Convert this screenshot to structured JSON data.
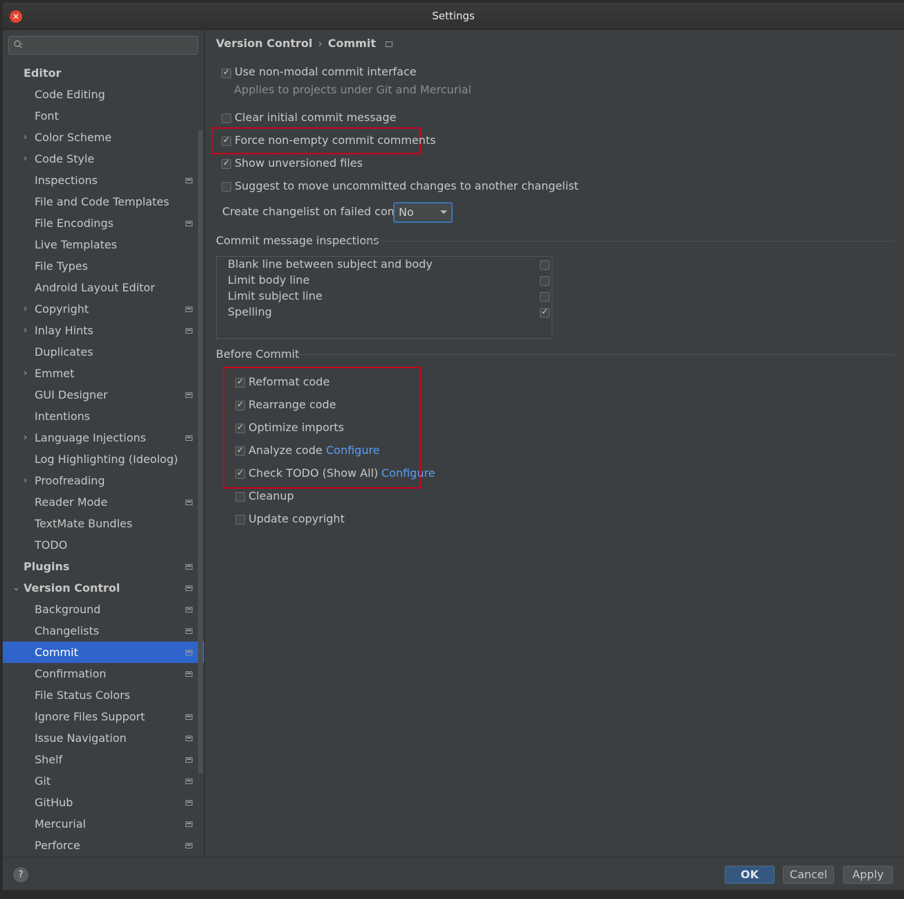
{
  "window": {
    "title": "Settings"
  },
  "search": {
    "placeholder": ""
  },
  "sidebar": {
    "items": [
      {
        "label": "Editor",
        "bold": true,
        "indent": 0,
        "arrow": "",
        "proj": false
      },
      {
        "label": "Code Editing",
        "indent": 1,
        "arrow": "",
        "proj": false
      },
      {
        "label": "Font",
        "indent": 1,
        "arrow": "",
        "proj": false
      },
      {
        "label": "Color Scheme",
        "indent": 1,
        "arrow": "›",
        "proj": false
      },
      {
        "label": "Code Style",
        "indent": 1,
        "arrow": "›",
        "proj": false
      },
      {
        "label": "Inspections",
        "indent": 1,
        "arrow": "",
        "proj": true
      },
      {
        "label": "File and Code Templates",
        "indent": 1,
        "arrow": "",
        "proj": false
      },
      {
        "label": "File Encodings",
        "indent": 1,
        "arrow": "",
        "proj": true
      },
      {
        "label": "Live Templates",
        "indent": 1,
        "arrow": "",
        "proj": false
      },
      {
        "label": "File Types",
        "indent": 1,
        "arrow": "",
        "proj": false
      },
      {
        "label": "Android Layout Editor",
        "indent": 1,
        "arrow": "",
        "proj": false
      },
      {
        "label": "Copyright",
        "indent": 1,
        "arrow": "›",
        "proj": true
      },
      {
        "label": "Inlay Hints",
        "indent": 1,
        "arrow": "›",
        "proj": true
      },
      {
        "label": "Duplicates",
        "indent": 1,
        "arrow": "",
        "proj": false
      },
      {
        "label": "Emmet",
        "indent": 1,
        "arrow": "›",
        "proj": false
      },
      {
        "label": "GUI Designer",
        "indent": 1,
        "arrow": "",
        "proj": true
      },
      {
        "label": "Intentions",
        "indent": 1,
        "arrow": "",
        "proj": false
      },
      {
        "label": "Language Injections",
        "indent": 1,
        "arrow": "›",
        "proj": true
      },
      {
        "label": "Log Highlighting (Ideolog)",
        "indent": 1,
        "arrow": "",
        "proj": false
      },
      {
        "label": "Proofreading",
        "indent": 1,
        "arrow": "›",
        "proj": false
      },
      {
        "label": "Reader Mode",
        "indent": 1,
        "arrow": "",
        "proj": true
      },
      {
        "label": "TextMate Bundles",
        "indent": 1,
        "arrow": "",
        "proj": false
      },
      {
        "label": "TODO",
        "indent": 1,
        "arrow": "",
        "proj": false
      },
      {
        "label": "Plugins",
        "bold": true,
        "indent": 0,
        "arrow": "",
        "proj": true
      },
      {
        "label": "Version Control",
        "bold": true,
        "indent": 0,
        "arrow": "⌄",
        "proj": true
      },
      {
        "label": "Background",
        "indent": 1,
        "arrow": "",
        "proj": true
      },
      {
        "label": "Changelists",
        "indent": 1,
        "arrow": "",
        "proj": true
      },
      {
        "label": "Commit",
        "indent": 1,
        "arrow": "",
        "proj": true,
        "selected": true
      },
      {
        "label": "Confirmation",
        "indent": 1,
        "arrow": "",
        "proj": true
      },
      {
        "label": "File Status Colors",
        "indent": 1,
        "arrow": "",
        "proj": false
      },
      {
        "label": "Ignore Files Support",
        "indent": 1,
        "arrow": "",
        "proj": true
      },
      {
        "label": "Issue Navigation",
        "indent": 1,
        "arrow": "",
        "proj": true
      },
      {
        "label": "Shelf",
        "indent": 1,
        "arrow": "",
        "proj": true
      },
      {
        "label": "Git",
        "indent": 1,
        "arrow": "",
        "proj": true
      },
      {
        "label": "GitHub",
        "indent": 1,
        "arrow": "",
        "proj": true
      },
      {
        "label": "Mercurial",
        "indent": 1,
        "arrow": "",
        "proj": true
      },
      {
        "label": "Perforce",
        "indent": 1,
        "arrow": "",
        "proj": true
      }
    ]
  },
  "breadcrumb": {
    "parent": "Version Control",
    "sep": "›",
    "current": "Commit"
  },
  "options": {
    "non_modal": {
      "label": "Use non-modal commit interface",
      "checked": true
    },
    "non_modal_hint": "Applies to projects under Git and Mercurial",
    "clear_initial": {
      "label": "Clear initial commit message",
      "checked": false
    },
    "force_non_empty": {
      "label": "Force non-empty commit comments",
      "checked": true
    },
    "show_unversioned": {
      "label": "Show unversioned files",
      "checked": true
    },
    "suggest_move": {
      "label": "Suggest to move uncommitted changes to another changelist",
      "checked": false
    },
    "create_changelist_label": "Create changelist on failed commit:",
    "create_changelist_value": "No"
  },
  "inspections": {
    "title": "Commit message inspections",
    "items": [
      {
        "label": "Blank line between subject and body",
        "checked": false
      },
      {
        "label": "Limit body line",
        "checked": false
      },
      {
        "label": "Limit subject line",
        "checked": false
      },
      {
        "label": "Spelling",
        "checked": true
      }
    ]
  },
  "before_commit": {
    "title": "Before Commit",
    "items": [
      {
        "label": "Reformat code",
        "checked": true,
        "link": ""
      },
      {
        "label": "Rearrange code",
        "checked": true,
        "link": ""
      },
      {
        "label": "Optimize imports",
        "checked": true,
        "link": ""
      },
      {
        "label": "Analyze code",
        "checked": true,
        "link": "Configure"
      },
      {
        "label": "Check TODO (Show All)",
        "checked": true,
        "link": "Configure"
      },
      {
        "label": "Cleanup",
        "checked": false,
        "link": ""
      },
      {
        "label": "Update copyright",
        "checked": false,
        "link": ""
      }
    ]
  },
  "footer": {
    "help": "?",
    "ok": "OK",
    "cancel": "Cancel",
    "apply": "Apply"
  },
  "colors": {
    "selection": "#2f65ca",
    "highlight_box": "#d0021b",
    "link": "#589df6"
  }
}
